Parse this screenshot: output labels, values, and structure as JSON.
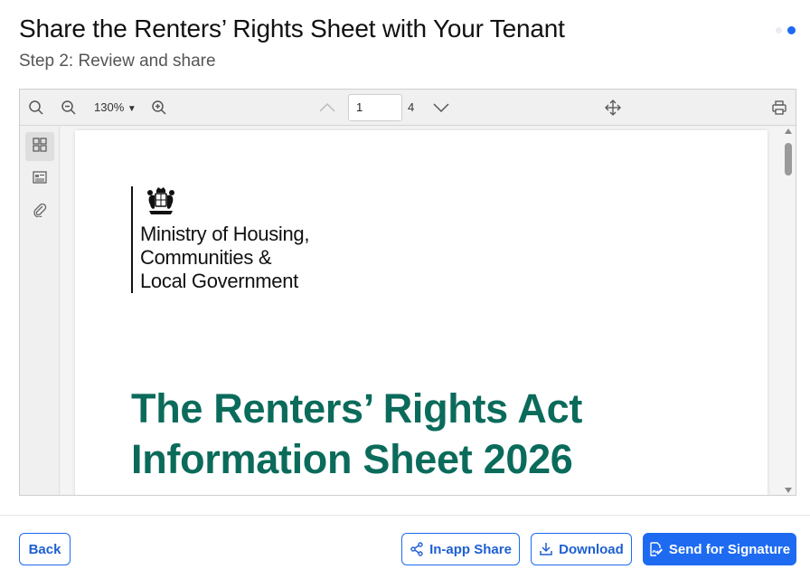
{
  "header": {
    "title": "Share the Renters’ Rights Sheet with Your Tenant",
    "subtitle": "Step 2: Review and share"
  },
  "progress": {
    "steps": 2,
    "current": 2
  },
  "viewer": {
    "zoom": "130%",
    "current_page": "1",
    "total_pages": "4"
  },
  "document": {
    "department": "Ministry of Housing,\nCommunities &\nLocal Government",
    "title": "The Renters’ Rights Act\nInformation Sheet 2026"
  },
  "footer": {
    "back_label": "Back",
    "share_label": "In-app Share",
    "download_label": "Download",
    "signature_label": "Send for Signature"
  },
  "colors": {
    "accent": "#1e6bf2",
    "doc_title": "#0b6b5b"
  }
}
